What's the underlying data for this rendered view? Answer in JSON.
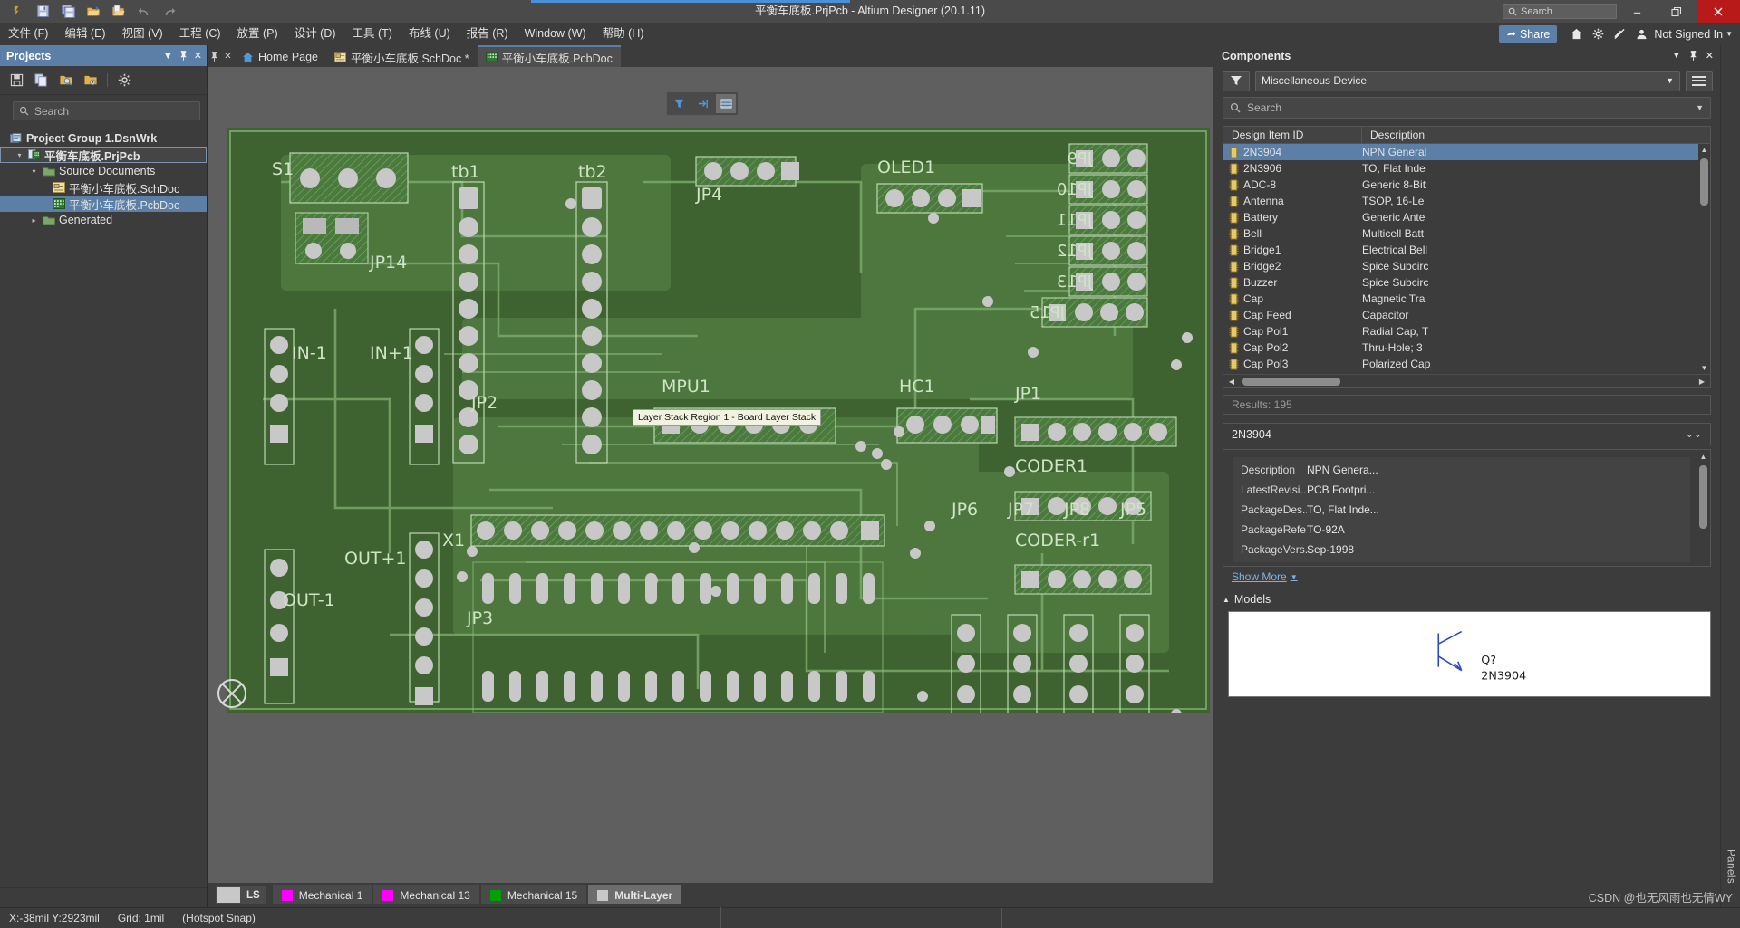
{
  "window": {
    "title": "平衡车底板.PrjPcb - Altium Designer (20.1.11)",
    "search_placeholder": "Search",
    "minimize": "—",
    "restore": "❐",
    "close": "✕",
    "quick_icons": [
      "altium-logo-icon",
      "save-icon",
      "save-all-icon",
      "open-icon",
      "open-project-icon",
      "undo-icon",
      "redo-icon"
    ]
  },
  "menubar": {
    "items": [
      {
        "label": "文件 (F)",
        "name": "menu-file"
      },
      {
        "label": "编辑 (E)",
        "name": "menu-edit"
      },
      {
        "label": "视图 (V)",
        "name": "menu-view"
      },
      {
        "label": "工程 (C)",
        "name": "menu-project"
      },
      {
        "label": "放置 (P)",
        "name": "menu-place"
      },
      {
        "label": "设计 (D)",
        "name": "menu-design"
      },
      {
        "label": "工具 (T)",
        "name": "menu-tools"
      },
      {
        "label": "布线 (U)",
        "name": "menu-route"
      },
      {
        "label": "报告 (R)",
        "name": "menu-reports"
      },
      {
        "label": "Window (W)",
        "name": "menu-window"
      },
      {
        "label": "帮助 (H)",
        "name": "menu-help"
      }
    ],
    "share_label": "Share",
    "signin_label": "Not Signed In"
  },
  "projects": {
    "panel_title": "Projects",
    "search_placeholder": "Search",
    "toolbar_icons": [
      "save-icon",
      "copy-icon",
      "open-folder-search-icon",
      "folder-settings-icon",
      "gear-icon"
    ],
    "tree": [
      {
        "label": "Project Group 1.DsnWrk",
        "icon": "workspace-icon",
        "indent": 0,
        "arrow": "",
        "bold": true,
        "state": "none"
      },
      {
        "label": "平衡车底板.PrjPcb",
        "icon": "pcb-project-icon",
        "indent": 1,
        "arrow": "▾",
        "bold": true,
        "state": "outline"
      },
      {
        "label": "Source Documents",
        "icon": "folder-icon",
        "indent": 2,
        "arrow": "▾",
        "bold": false,
        "state": "none"
      },
      {
        "label": "平衡小车底板.SchDoc",
        "icon": "sch-doc-icon",
        "indent": 3,
        "arrow": "",
        "bold": false,
        "state": "none"
      },
      {
        "label": "平衡小车底板.PcbDoc",
        "icon": "pcb-doc-icon",
        "indent": 3,
        "arrow": "",
        "bold": false,
        "state": "selected"
      },
      {
        "label": "Generated",
        "icon": "folder-icon",
        "indent": 2,
        "arrow": "▸",
        "bold": false,
        "state": "none"
      }
    ]
  },
  "editor": {
    "tabs": [
      {
        "label": "Home Page",
        "icon": "home-icon",
        "active": false
      },
      {
        "label": "平衡小车底板.SchDoc *",
        "icon": "sch-doc-icon",
        "active": false
      },
      {
        "label": "平衡小车底板.PcbDoc",
        "icon": "pcb-doc-icon",
        "active": true
      }
    ],
    "float_toolbar": [
      {
        "name": "filter-icon",
        "glyph": "▼",
        "active": false
      },
      {
        "name": "select-mask-icon",
        "glyph": "⇥",
        "active": false
      },
      {
        "name": "board-planning-icon",
        "glyph": "▤",
        "active": true
      }
    ],
    "tooltip": "Layer Stack Region 1 - Board Layer Stack",
    "pcb_designators": [
      "S1",
      "JP14",
      "tb1",
      "tb2",
      "JP4",
      "OLED1",
      "JP9",
      "JP10",
      "JP11",
      "JP12",
      "JP13",
      "JP15",
      "IN-1",
      "IN+1",
      "JP2",
      "MPU1",
      "HC1",
      "JP1",
      "CODER1",
      "CODER-r1",
      "OUT+1",
      "OUT-1",
      "JP3",
      "JP6",
      "JP7",
      "JP8",
      "JP5",
      "X1"
    ]
  },
  "layers": {
    "ls_label": "LS",
    "tabs": [
      {
        "label": "Mechanical 1",
        "color": "#ff00ff",
        "active": false
      },
      {
        "label": "Mechanical 13",
        "color": "#ff00ff",
        "active": false
      },
      {
        "label": "Mechanical 15",
        "color": "#00a000",
        "active": false
      },
      {
        "label": "Multi-Layer",
        "color": "#c8c8c8",
        "active": true
      }
    ]
  },
  "components": {
    "panel_title": "Components",
    "library_value": "Miscellaneous Device",
    "search_placeholder": "Search",
    "columns": [
      "Design Item ID",
      "Description"
    ],
    "rows": [
      {
        "id": "2N3904",
        "desc": "NPN General",
        "selected": true
      },
      {
        "id": "2N3906",
        "desc": "TO, Flat Inde",
        "selected": false
      },
      {
        "id": "ADC-8",
        "desc": "Generic 8-Bit",
        "selected": false
      },
      {
        "id": "Antenna",
        "desc": "TSOP, 16-Le",
        "selected": false
      },
      {
        "id": "Battery",
        "desc": "Generic Ante",
        "selected": false
      },
      {
        "id": "Bell",
        "desc": "Multicell Batt",
        "selected": false
      },
      {
        "id": "Bridge1",
        "desc": "Electrical Bell",
        "selected": false
      },
      {
        "id": "Bridge2",
        "desc": "Spice Subcirc",
        "selected": false
      },
      {
        "id": "Buzzer",
        "desc": "Spice Subcirc",
        "selected": false
      },
      {
        "id": "Cap",
        "desc": "Magnetic Tra",
        "selected": false
      },
      {
        "id": "Cap Feed",
        "desc": "Capacitor",
        "selected": false
      },
      {
        "id": "Cap Pol1",
        "desc": "Radial Cap, T",
        "selected": false
      },
      {
        "id": "Cap Pol2",
        "desc": "Thru-Hole; 3",
        "selected": false
      },
      {
        "id": "Cap Pol3",
        "desc": "Polarized Cap",
        "selected": false
      }
    ],
    "results": "Results: 195",
    "detail_name": "2N3904",
    "properties": [
      {
        "key": "Description",
        "value": "NPN Genera..."
      },
      {
        "key": "LatestRevisi...",
        "value": "PCB Footpri..."
      },
      {
        "key": "PackageDes...",
        "value": "TO, Flat Inde..."
      },
      {
        "key": "PackageRefe...",
        "value": "TO-92A"
      },
      {
        "key": "PackageVers...",
        "value": "Sep-1998"
      }
    ],
    "show_more": "Show More",
    "models_title": "Models",
    "model_label_1": "Q?",
    "model_label_2": "2N3904",
    "side_tab": "Panels"
  },
  "statusbar": {
    "coords": "X:-38mil Y:2923mil",
    "grid": "Grid: 1mil",
    "snap": "(Hotspot Snap)"
  },
  "watermark": "CSDN @也无风雨也无情WY",
  "colors": {
    "accent": "#5b7fa6",
    "board_green": "#3e6331",
    "pad_gray": "#c8c8c8",
    "close_red": "#b81a1a",
    "link_blue": "#7fb0e0"
  }
}
